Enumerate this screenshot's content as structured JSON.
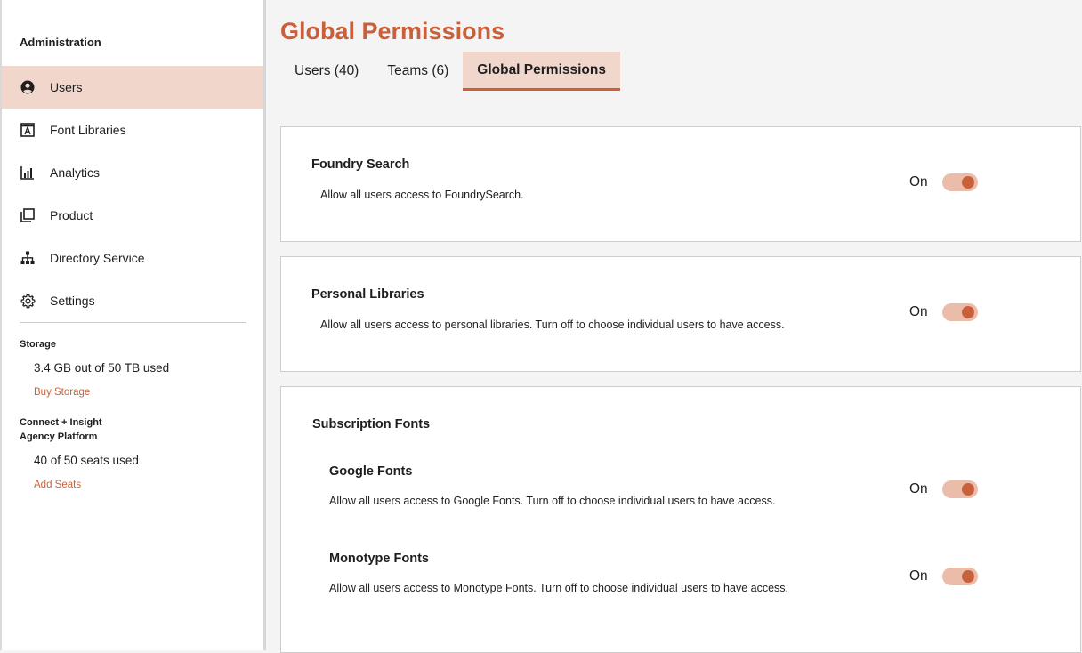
{
  "sidebar": {
    "title": "Administration",
    "items": [
      {
        "label": "Users",
        "icon": "user-circle-icon",
        "active": true
      },
      {
        "label": "Font Libraries",
        "icon": "font-library-icon"
      },
      {
        "label": "Analytics",
        "icon": "bar-chart-icon"
      },
      {
        "label": "Product",
        "icon": "product-icon"
      },
      {
        "label": "Directory Service",
        "icon": "org-chart-icon"
      },
      {
        "label": "Settings",
        "icon": "gear-icon"
      }
    ],
    "storage": {
      "title": "Storage",
      "used": "3.4 GB out of 50 TB used",
      "link": "Buy Storage"
    },
    "platform": {
      "title_line1": "Connect + Insight",
      "title_line2": "Agency Platform",
      "seats": "40 of 50 seats used",
      "link": "Add Seats"
    }
  },
  "main": {
    "title": "Global Permissions",
    "tabs": [
      {
        "label": "Users (40)"
      },
      {
        "label": "Teams (6)"
      },
      {
        "label": "Global Permissions",
        "active": true
      }
    ],
    "cards": {
      "foundry": {
        "title": "Foundry Search",
        "desc": "Allow all users access to FoundrySearch.",
        "toggle": "On"
      },
      "personal": {
        "title": "Personal Libraries",
        "desc": "Allow all users access to personal libraries. Turn off to choose individual users to have access.",
        "toggle": "On"
      },
      "subscription": {
        "title": "Subscription Fonts",
        "google": {
          "title": "Google Fonts",
          "desc": "Allow all users access to Google Fonts. Turn off to choose individual users to have access.",
          "toggle": "On"
        },
        "monotype": {
          "title": "Monotype Fonts",
          "desc": "Allow all users access to Monotype Fonts. Turn off to choose individual users to have access.",
          "toggle": "On"
        }
      }
    }
  },
  "colors": {
    "accent": "#c8613b",
    "active_bg": "#f1d6cc",
    "toggle_track": "#ecbcab"
  }
}
